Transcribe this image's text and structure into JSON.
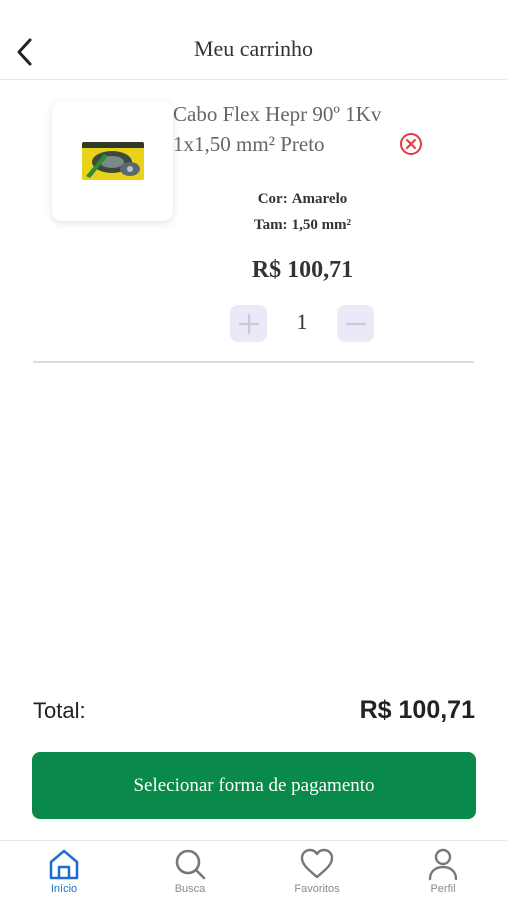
{
  "header": {
    "title": "Meu carrinho"
  },
  "item": {
    "name": "Cabo Flex Hepr 90º 1Kv 1x1,50 mm² Preto",
    "color_label": "Cor:",
    "color_value": "Amarelo",
    "size_label": "Tam:",
    "size_value": "1,50 mm²",
    "price": "R$ 100,71",
    "quantity": "1"
  },
  "summary": {
    "total_label": "Total:",
    "total_value": "R$ 100,71"
  },
  "checkout": {
    "button_label": "Selecionar forma de pagamento"
  },
  "nav": {
    "items": [
      {
        "label": "Início",
        "icon": "home-icon",
        "active": true
      },
      {
        "label": "Busca",
        "icon": "search-icon",
        "active": false
      },
      {
        "label": "Favoritos",
        "icon": "heart-icon",
        "active": false
      },
      {
        "label": "Perfil",
        "icon": "user-icon",
        "active": false
      }
    ]
  },
  "colors": {
    "accent": "#0a8a4a",
    "nav_active": "#1f6fd1",
    "remove": "#e0393e",
    "stepper_bg": "#ebe9f8"
  }
}
